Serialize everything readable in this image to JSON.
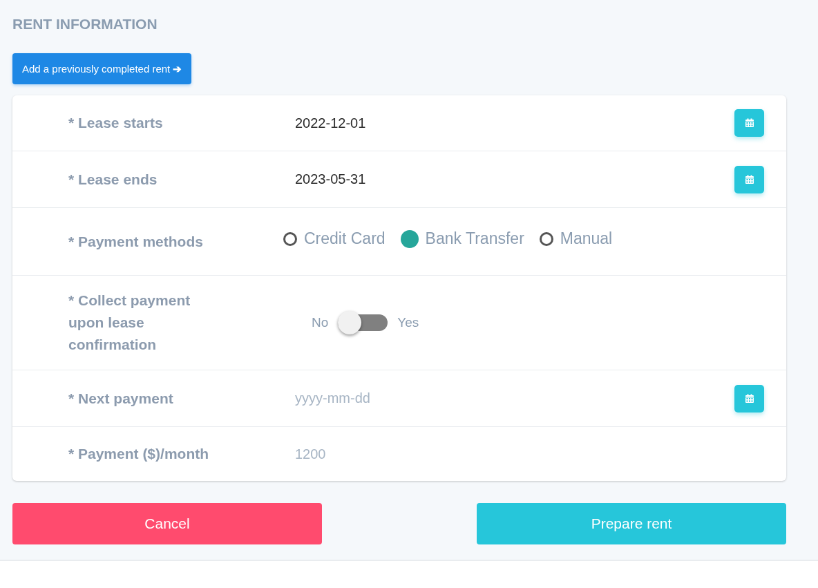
{
  "title": "RENT INFORMATION",
  "add_button": {
    "label": "Add a previously completed rent",
    "icon": "➔"
  },
  "fields": [
    {
      "kind": "date",
      "label": "* Lease starts",
      "value": "2022-12-01"
    },
    {
      "kind": "date",
      "label": "* Lease ends",
      "value": "2023-05-31"
    },
    {
      "kind": "radio",
      "label": "* Payment methods",
      "options": [
        {
          "label": "Credit Card",
          "selected": false
        },
        {
          "label": "Bank Transfer",
          "selected": true
        },
        {
          "label": "Manual",
          "selected": false
        }
      ]
    },
    {
      "kind": "toggle",
      "label": "* Collect payment upon lease confirmation",
      "off_label": "No",
      "on_label": "Yes",
      "on": false
    },
    {
      "kind": "date",
      "label": "* Next payment",
      "placeholder": "yyyy-mm-dd"
    },
    {
      "kind": "text",
      "label": "* Payment ($)/month",
      "placeholder": "1200"
    }
  ],
  "buttons": [
    {
      "kind": "cancel",
      "label": "Cancel"
    },
    {
      "kind": "submit",
      "label": "Prepare rent"
    }
  ]
}
